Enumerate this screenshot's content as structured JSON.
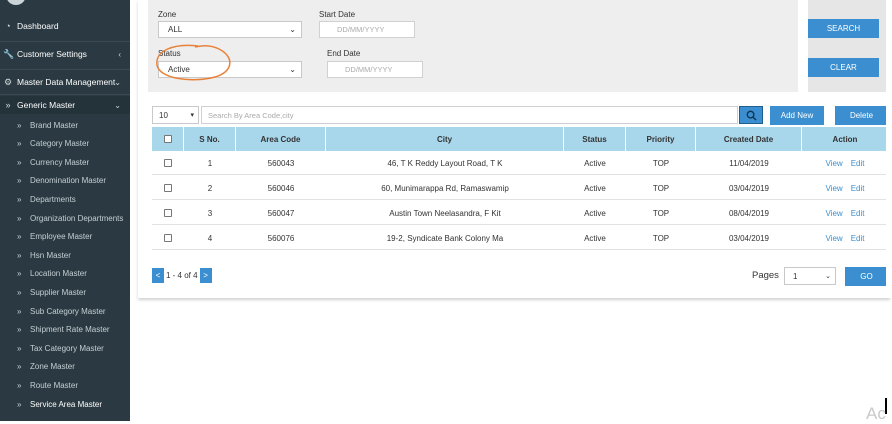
{
  "sidebar": {
    "top_items": [
      {
        "label": "Dashboard",
        "icon": "dashboard-icon"
      },
      {
        "label": "Customer Settings",
        "icon": "wrench-icon"
      },
      {
        "label": "Master Data Management",
        "icon": "gear-icon"
      }
    ],
    "group": {
      "label": "Generic Master"
    },
    "sub_items": [
      "Brand Master",
      "Category Master",
      "Currency Master",
      "Denomination Master",
      "Departments",
      "Organization Departments",
      "Employee Master",
      "Hsn Master",
      "Location Master",
      "Supplier Master",
      "Sub Category Master",
      "Shipment Rate Master",
      "Tax Category Master",
      "Zone Master",
      "Route Master",
      "Service Area Master"
    ],
    "active_item": "Service Area Master"
  },
  "filters": {
    "zone_label": "Zone",
    "zone_value": "ALL",
    "status_label": "Status",
    "status_value": "Active",
    "start_date_label": "Start Date",
    "start_date_placeholder": "DD/MM/YYYY",
    "end_date_label": "End Date",
    "end_date_placeholder": "DD/MM/YYYY",
    "search_button": "SEARCH",
    "clear_button": "CLEAR"
  },
  "toolbar": {
    "page_size": "10",
    "search_placeholder": "Search By Area Code,city",
    "add_button": "Add New",
    "delete_button": "Delete"
  },
  "table": {
    "columns": [
      "S No.",
      "Area Code",
      "City",
      "Status",
      "Priority",
      "Created Date",
      "Action"
    ],
    "rows": [
      {
        "sno": "1",
        "area_code": "560043",
        "city": "46, T K Reddy Layout Road, T K",
        "status": "Active",
        "priority": "TOP",
        "created": "11/04/2019"
      },
      {
        "sno": "2",
        "area_code": "560046",
        "city": "60, Munimarappa Rd, Ramaswamip",
        "status": "Active",
        "priority": "TOP",
        "created": "03/04/2019"
      },
      {
        "sno": "3",
        "area_code": "560047",
        "city": "Austin Town Neelasandra, F Kit",
        "status": "Active",
        "priority": "TOP",
        "created": "08/04/2019"
      },
      {
        "sno": "4",
        "area_code": "560076",
        "city": "19-2, Syndicate Bank Colony Ma",
        "status": "Active",
        "priority": "TOP",
        "created": "03/04/2019"
      }
    ],
    "view_label": "View",
    "edit_label": "Edit"
  },
  "pagination": {
    "prev": "<",
    "range": "1 - 4 of 4",
    "next": ">",
    "pages_label": "Pages",
    "page_value": "1",
    "go_button": "GO"
  },
  "overlay_text": "Ac",
  "colors": {
    "sidebar_bg": "#2b3a42",
    "accent": "#3b8fd0",
    "table_header": "#a8d6ea",
    "annotation": "#e8823a"
  }
}
